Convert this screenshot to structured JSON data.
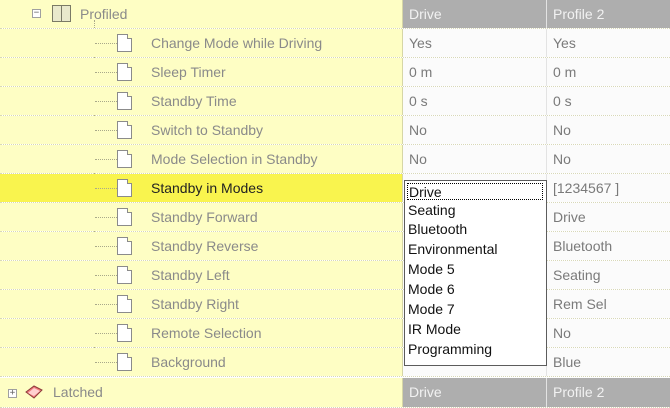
{
  "window_title": "Profiled",
  "columns": {
    "col1": "Drive",
    "col2": "Profile 2"
  },
  "section_profiled": {
    "label": "Profiled",
    "expanded_glyph": "−",
    "icon": "book-icon"
  },
  "rows": [
    {
      "label": "Change Mode while Driving",
      "v1": "Yes",
      "v2": "Yes"
    },
    {
      "label": "Sleep Timer",
      "v1": "0 m",
      "v2": "0 m"
    },
    {
      "label": "Standby Time",
      "v1": "0 s",
      "v2": "0 s"
    },
    {
      "label": "Switch to Standby",
      "v1": "No",
      "v2": "No"
    },
    {
      "label": "Mode Selection in Standby",
      "v1": "No",
      "v2": "No"
    },
    {
      "label": "Standby in Modes",
      "v1": "Drive",
      "v2": "[1234567 ]",
      "selected": true
    },
    {
      "label": "Standby Forward",
      "v1": "",
      "v2": "Drive"
    },
    {
      "label": "Standby Reverse",
      "v1": "",
      "v2": "Bluetooth"
    },
    {
      "label": "Standby Left",
      "v1": "",
      "v2": "Seating"
    },
    {
      "label": "Standby Right",
      "v1": "",
      "v2": "Rem Sel"
    },
    {
      "label": "Remote Selection",
      "v1": "",
      "v2": "No"
    },
    {
      "label": "Background",
      "v1": "",
      "v2": "Blue"
    }
  ],
  "section_latched": {
    "label": "Latched",
    "collapsed_glyph": "+",
    "icon": "latched-icon",
    "col1": "Drive",
    "col2": "Profile 2"
  },
  "dropdown": {
    "selected": "Drive",
    "options": [
      "Seating",
      "Bluetooth",
      "Environmental",
      "Mode 5",
      "Mode 6",
      "Mode 7",
      "IR Mode",
      "Programming"
    ]
  },
  "colors": {
    "tree_bg": "#fefec4",
    "highlight_bg": "#f9f44e",
    "header_bg": "#aeaeae"
  }
}
